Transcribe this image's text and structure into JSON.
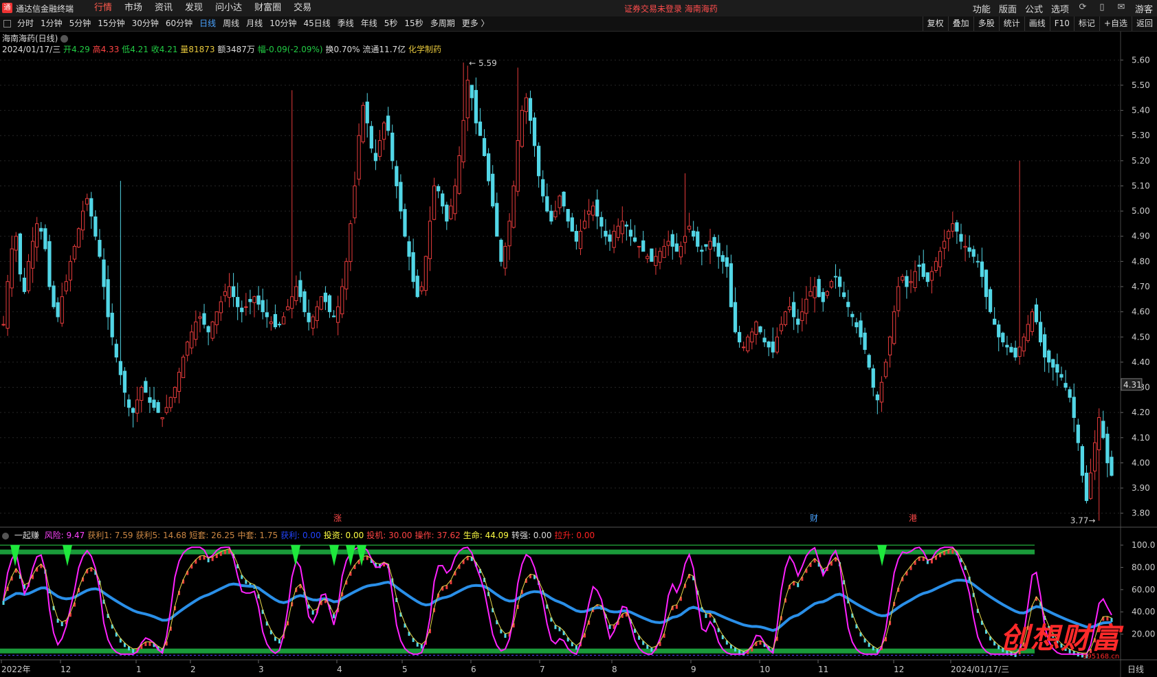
{
  "app": {
    "logo": "通",
    "name": "通达信金融终端"
  },
  "menu": [
    "行情",
    "市场",
    "资讯",
    "发现",
    "问小达",
    "财富圈",
    "交易"
  ],
  "notice": "证券交易未登录  海南海药",
  "right_menu": [
    "功能",
    "版面",
    "公式",
    "选项",
    "游客"
  ],
  "periods": [
    "分时",
    "1分钟",
    "5分钟",
    "15分钟",
    "30分钟",
    "60分钟",
    "日线",
    "周线",
    "月线",
    "10分钟",
    "45日线",
    "季线",
    "年线",
    "5秒",
    "15秒",
    "多周期",
    "更多 〉"
  ],
  "tools": [
    "复权",
    "叠加",
    "多股",
    "统计",
    "画线",
    "F10",
    "标记",
    "+自选",
    "返回"
  ],
  "stock": {
    "title": "海南海药(日线)",
    "date": "2024/01/17/三",
    "open_lbl": "开",
    "open": "4.29",
    "high_lbl": "高",
    "high": "4.33",
    "low_lbl": "低",
    "low": "4.21",
    "close_lbl": "收",
    "close": "4.21",
    "vol_lbl": "量",
    "vol": "81873",
    "amt_lbl": "额",
    "amt": "3487万",
    "chg_lbl": "幅",
    "chg": "-0.09(-2.09%)",
    "turn_lbl": "换",
    "turn": "0.70%",
    "float_lbl": "流通",
    "float": "11.7亿",
    "sector": "化学制药"
  },
  "price_axis": [
    "5.60",
    "5.50",
    "5.40",
    "5.30",
    "5.20",
    "5.10",
    "5.00",
    "4.90",
    "4.80",
    "4.70",
    "4.60",
    "4.50",
    "4.40",
    "4.30",
    "4.20",
    "4.10",
    "4.00",
    "3.90",
    "3.80"
  ],
  "current_price": "4.31",
  "max_mark": "5.59",
  "min_mark": "3.77",
  "event_marks": {
    "zhang": "涨",
    "cai": "财",
    "gang": "港"
  },
  "indicator": {
    "name": "一起赚",
    "items": [
      {
        "label": "风险:",
        "value": "9.47",
        "color": "#ff44ff"
      },
      {
        "label": "获利1:",
        "value": "7.59",
        "color": "#cc8844"
      },
      {
        "label": "获利5:",
        "value": "14.68",
        "color": "#cc8844"
      },
      {
        "label": "短套:",
        "value": "26.25",
        "color": "#cc8844"
      },
      {
        "label": "中套:",
        "value": "1.75",
        "color": "#cc8844"
      },
      {
        "label": "获利:",
        "value": "0.00",
        "color": "#2244ff"
      },
      {
        "label": "投资:",
        "value": "0.00",
        "color": "#ffff44"
      },
      {
        "label": "投机:",
        "value": "30.00",
        "color": "#ff4444"
      },
      {
        "label": "操作:",
        "value": "37.62",
        "color": "#ff4444"
      },
      {
        "label": "生命:",
        "value": "44.09",
        "color": "#ffff44"
      },
      {
        "label": "转强:",
        "value": "0.00",
        "color": "#dddddd"
      },
      {
        "label": "拉升:",
        "value": "0.00",
        "color": "#ff2222"
      }
    ]
  },
  "ind_axis": [
    "100.0",
    "80.00",
    "60.00",
    "40.00",
    "20.00"
  ],
  "x_axis": [
    "2022年",
    "12",
    "1",
    "2",
    "3",
    "4",
    "5",
    "6",
    "7",
    "8",
    "9",
    "10",
    "11",
    "12",
    "2024/01/17/三"
  ],
  "x_period": "日线",
  "watermark": "创想财富",
  "watermark_url": "995168.cn",
  "colors": {
    "up": "#e83c3c",
    "down": "#52d6e6",
    "ma_blue": "#2a8fe8",
    "magenta": "#ff22ff",
    "yellow": "#e8d84a",
    "green": "#1a9a3a"
  },
  "chart_data": {
    "type": "candlestick",
    "y_range": [
      3.75,
      5.62
    ],
    "max": 5.59,
    "min": 3.77,
    "last": 4.21,
    "closes": [
      4.55,
      4.72,
      4.85,
      4.9,
      4.75,
      4.68,
      4.8,
      4.88,
      4.95,
      4.92,
      4.85,
      4.7,
      4.62,
      4.58,
      4.66,
      4.72,
      4.8,
      4.86,
      4.93,
      5.0,
      5.05,
      4.98,
      4.9,
      4.82,
      4.7,
      4.58,
      4.5,
      4.42,
      4.35,
      4.28,
      4.22,
      4.2,
      4.25,
      4.3,
      4.28,
      4.24,
      4.22,
      4.2,
      4.18,
      4.22,
      4.26,
      4.3,
      4.36,
      4.42,
      4.48,
      4.52,
      4.56,
      4.58,
      4.55,
      4.52,
      4.56,
      4.6,
      4.64,
      4.68,
      4.7,
      4.66,
      4.62,
      4.6,
      4.62,
      4.64,
      4.66,
      4.63,
      4.6,
      4.58,
      4.56,
      4.54,
      4.55,
      4.58,
      4.62,
      4.66,
      4.7,
      4.66,
      4.6,
      4.56,
      4.58,
      4.62,
      4.66,
      4.64,
      4.6,
      4.58,
      4.62,
      4.7,
      4.8,
      4.95,
      5.1,
      5.3,
      5.42,
      5.35,
      5.25,
      5.2,
      5.28,
      5.35,
      5.32,
      5.2,
      5.1,
      5.0,
      4.9,
      4.82,
      4.72,
      4.66,
      4.7,
      4.82,
      4.96,
      5.1,
      5.08,
      5.02,
      4.96,
      5.02,
      5.1,
      5.22,
      5.36,
      5.52,
      5.45,
      5.35,
      5.3,
      5.22,
      5.12,
      5.02,
      4.9,
      4.8,
      4.86,
      4.96,
      5.1,
      5.28,
      5.4,
      5.45,
      5.36,
      5.26,
      5.14,
      5.06,
      5.0,
      4.96,
      5.0,
      5.06,
      5.02,
      4.96,
      4.92,
      4.88,
      4.92,
      4.96,
      5.0,
      5.02,
      4.98,
      4.94,
      4.9,
      4.88,
      4.92,
      4.94,
      4.96,
      4.94,
      4.9,
      4.88,
      4.86,
      4.84,
      4.82,
      4.8,
      4.82,
      4.84,
      4.86,
      4.88,
      4.86,
      4.84,
      4.86,
      4.9,
      4.94,
      4.9,
      4.86,
      4.84,
      4.86,
      4.88,
      4.86,
      4.82,
      4.8,
      4.78,
      4.62,
      4.52,
      4.48,
      4.46,
      4.5,
      4.52,
      4.56,
      4.52,
      4.48,
      4.46,
      4.44,
      4.5,
      4.55,
      4.6,
      4.62,
      4.58,
      4.55,
      4.6,
      4.65,
      4.68,
      4.7,
      4.66,
      4.64,
      4.68,
      4.72,
      4.74,
      4.7,
      4.66,
      4.62,
      4.58,
      4.54,
      4.5,
      4.45,
      4.38,
      4.3,
      4.25,
      4.32,
      4.4,
      4.5,
      4.6,
      4.7,
      4.74,
      4.7,
      4.72,
      4.76,
      4.78,
      4.74,
      4.72,
      4.76,
      4.8,
      4.84,
      4.88,
      4.92,
      4.95,
      4.92,
      4.88,
      4.86,
      4.84,
      4.82,
      4.8,
      4.74,
      4.66,
      4.6,
      4.55,
      4.5,
      4.48,
      4.46,
      4.44,
      4.42,
      4.46,
      4.5,
      4.55,
      4.6,
      4.56,
      4.48,
      4.42,
      4.4,
      4.38,
      4.36,
      4.34,
      4.3,
      4.26,
      4.18,
      4.08,
      3.95,
      3.85,
      3.96,
      4.08,
      4.18,
      4.1,
      4.0,
      3.95
    ],
    "spikes_high": {
      "28": 5.12,
      "69": 5.48,
      "110": 5.59,
      "123": 5.57,
      "163": 5.15,
      "243": 5.2,
      "268": 4.48
    }
  }
}
